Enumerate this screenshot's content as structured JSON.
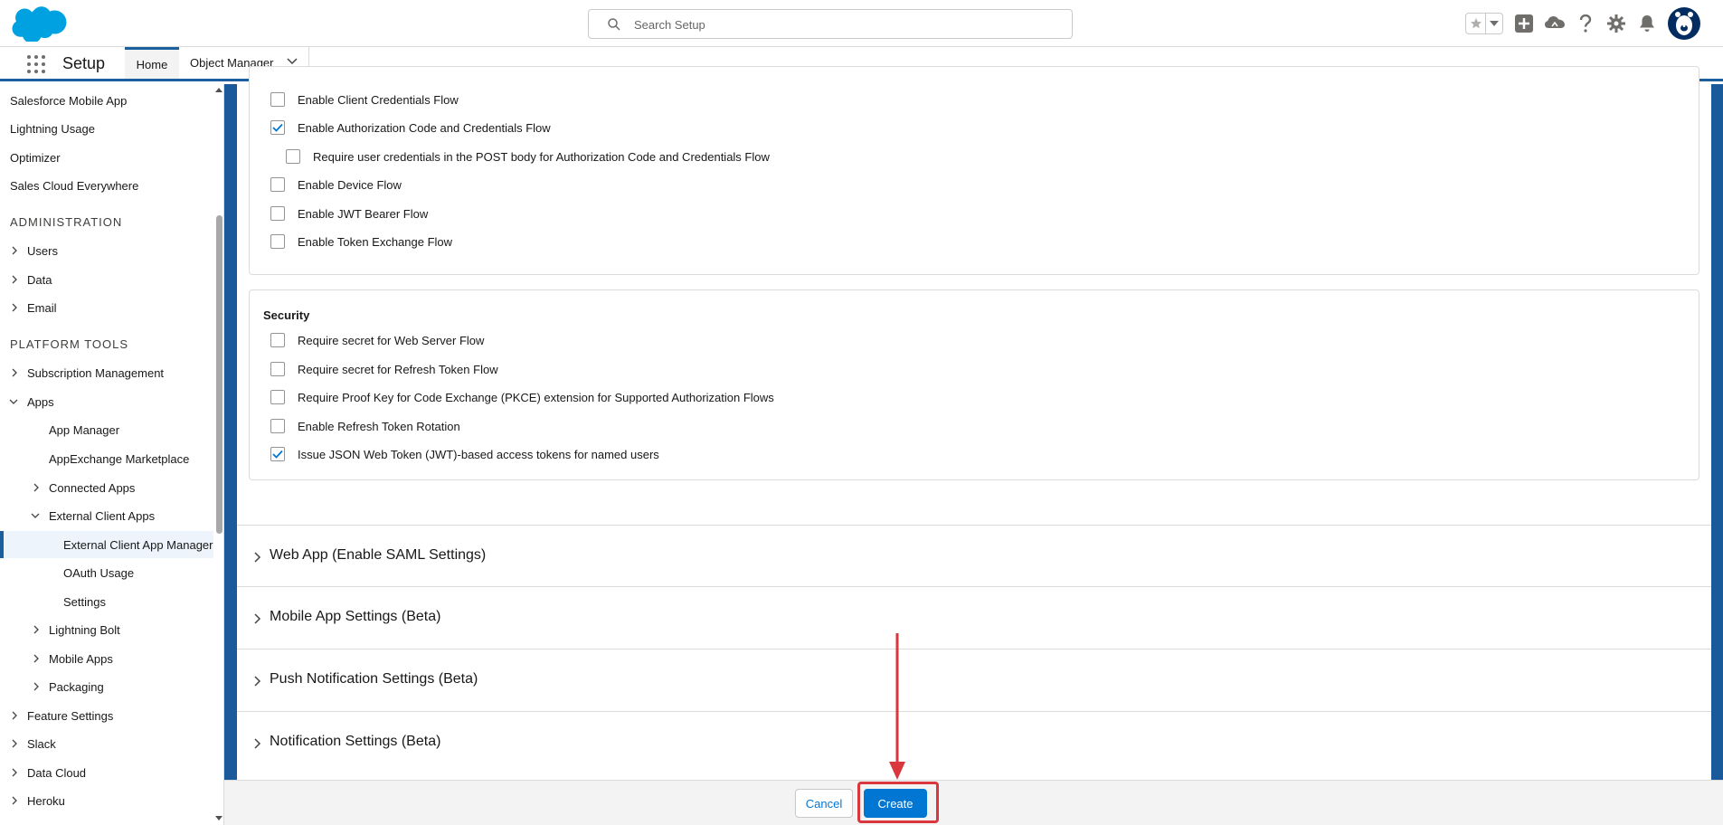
{
  "header": {
    "search_placeholder": "Search Setup",
    "icons": [
      "favorites-star-icon",
      "favorites-dropdown-icon",
      "global-actions-add-icon",
      "trailhead-guidance-icon",
      "help-icon",
      "setup-gear-icon",
      "notifications-bell-icon",
      "user-avatar"
    ],
    "brand_color": "#00a1e0"
  },
  "nav": {
    "app_name": "Setup",
    "tabs": [
      {
        "label": "Home",
        "active": true
      },
      {
        "label": "Object Manager",
        "active": false
      }
    ]
  },
  "sidebar": {
    "items": [
      {
        "label": "Salesforce Mobile App",
        "level": 0
      },
      {
        "label": "Lightning Usage",
        "level": 0
      },
      {
        "label": "Optimizer",
        "level": 0
      },
      {
        "label": "Sales Cloud Everywhere",
        "level": 0
      }
    ],
    "sections": {
      "administration": "ADMINISTRATION",
      "platform_tools": "PLATFORM TOOLS"
    },
    "admin_items": [
      "Users",
      "Data",
      "Email"
    ],
    "platform_items": {
      "subscription": "Subscription Management",
      "apps": "Apps",
      "app_manager": "App Manager",
      "appexchange": "AppExchange Marketplace",
      "connected_apps": "Connected Apps",
      "external_client_apps": "External Client Apps",
      "ecam": "External Client App Manager",
      "oauth_usage": "OAuth Usage",
      "settings": "Settings",
      "lightning_bolt": "Lightning Bolt",
      "mobile_apps": "Mobile Apps",
      "packaging": "Packaging",
      "feature_settings": "Feature Settings",
      "slack": "Slack",
      "data_cloud": "Data Cloud",
      "heroku": "Heroku"
    }
  },
  "flow_enablement": {
    "options": [
      {
        "label": "Enable Client Credentials Flow",
        "checked": false
      },
      {
        "label": "Enable Authorization Code and Credentials Flow",
        "checked": true
      },
      {
        "label": "Require user credentials in the POST body for Authorization Code and Credentials Flow",
        "checked": false
      },
      {
        "label": "Enable Device Flow",
        "checked": false
      },
      {
        "label": "Enable JWT Bearer Flow",
        "checked": false
      },
      {
        "label": "Enable Token Exchange Flow",
        "checked": false
      }
    ]
  },
  "security": {
    "title": "Security",
    "options": [
      {
        "label": "Require secret for Web Server Flow",
        "checked": false
      },
      {
        "label": "Require secret for Refresh Token Flow",
        "checked": false
      },
      {
        "label": "Require Proof Key for Code Exchange (PKCE) extension for Supported Authorization Flows",
        "checked": false
      },
      {
        "label": "Enable Refresh Token Rotation",
        "checked": false
      },
      {
        "label": "Issue JSON Web Token (JWT)-based access tokens for named users",
        "checked": true
      }
    ]
  },
  "accordions": [
    {
      "label": "Web App (Enable SAML Settings)"
    },
    {
      "label": "Mobile App Settings (Beta)"
    },
    {
      "label": "Push Notification Settings (Beta)"
    },
    {
      "label": "Notification Settings (Beta)"
    }
  ],
  "footer": {
    "cancel_label": "Cancel",
    "create_label": "Create",
    "annotation_color": "#d9363e"
  }
}
